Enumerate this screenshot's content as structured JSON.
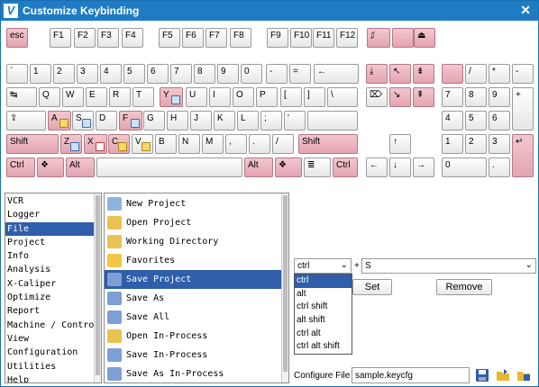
{
  "window": {
    "title": "Customize Keybinding",
    "close_label": "✕",
    "app_icon_letter": "V"
  },
  "keyboard": {
    "keys": [
      [
        "esc",
        6,
        8,
        24,
        "p",
        ""
      ],
      [
        "F1",
        54,
        8,
        24,
        "",
        ""
      ],
      [
        "F2",
        81,
        8,
        24,
        "",
        ""
      ],
      [
        "F3",
        107,
        8,
        24,
        "",
        ""
      ],
      [
        "F4",
        134,
        8,
        24,
        "",
        ""
      ],
      [
        "F5",
        175,
        8,
        24,
        "",
        ""
      ],
      [
        "F6",
        201,
        8,
        24,
        "",
        ""
      ],
      [
        "F7",
        227,
        8,
        24,
        "",
        ""
      ],
      [
        "F8",
        254,
        8,
        24,
        "",
        ""
      ],
      [
        "F9",
        295,
        8,
        24,
        "",
        ""
      ],
      [
        "F10",
        321,
        8,
        24,
        "",
        ""
      ],
      [
        "F11",
        346,
        8,
        24,
        "",
        ""
      ],
      [
        "F12",
        372,
        8,
        24,
        "",
        ""
      ],
      [
        "⎎",
        406,
        8,
        26,
        "p",
        ""
      ],
      [
        "",
        434,
        8,
        24,
        "p",
        ""
      ],
      [
        "⏏",
        458,
        8,
        24,
        "p",
        ""
      ],
      [
        "`",
        6,
        48,
        24,
        "",
        ""
      ],
      [
        "1",
        32,
        48,
        24,
        "",
        ""
      ],
      [
        "2",
        58,
        48,
        24,
        "",
        ""
      ],
      [
        "3",
        84,
        48,
        24,
        "",
        ""
      ],
      [
        "4",
        110,
        48,
        24,
        "",
        ""
      ],
      [
        "5",
        136,
        48,
        24,
        "",
        ""
      ],
      [
        "6",
        162,
        48,
        24,
        "",
        ""
      ],
      [
        "7",
        188,
        48,
        24,
        "",
        ""
      ],
      [
        "8",
        214,
        48,
        24,
        "",
        ""
      ],
      [
        "9",
        240,
        48,
        24,
        "",
        ""
      ],
      [
        "0",
        266,
        48,
        24,
        "",
        ""
      ],
      [
        "-",
        294,
        48,
        24,
        "",
        ""
      ],
      [
        "=",
        320,
        48,
        24,
        "",
        ""
      ],
      [
        "←",
        347,
        48,
        50,
        "",
        ""
      ],
      [
        "⤓",
        405,
        48,
        24,
        "p",
        ""
      ],
      [
        "↖",
        431,
        48,
        24,
        "p",
        ""
      ],
      [
        "⇟",
        457,
        48,
        24,
        "p",
        ""
      ],
      [
        "",
        489,
        48,
        24,
        "p",
        ""
      ],
      [
        "/",
        515,
        48,
        24,
        "",
        ""
      ],
      [
        "*",
        541,
        48,
        24,
        "",
        ""
      ],
      [
        "-",
        567,
        48,
        24,
        "",
        ""
      ],
      [
        "↹",
        6,
        74,
        34,
        "",
        ""
      ],
      [
        "Q",
        42,
        74,
        24,
        "",
        ""
      ],
      [
        "W",
        68,
        74,
        24,
        "",
        ""
      ],
      [
        "E",
        94,
        74,
        24,
        "",
        ""
      ],
      [
        "R",
        120,
        74,
        24,
        "",
        ""
      ],
      [
        "T",
        146,
        74,
        24,
        "",
        ""
      ],
      [
        "Y",
        176,
        74,
        26,
        "p",
        "b"
      ],
      [
        "U",
        205,
        74,
        24,
        "",
        ""
      ],
      [
        "I",
        231,
        74,
        24,
        "",
        ""
      ],
      [
        "O",
        257,
        74,
        24,
        "",
        ""
      ],
      [
        "P",
        283,
        74,
        24,
        "",
        ""
      ],
      [
        "[",
        310,
        74,
        24,
        "",
        ""
      ],
      [
        "]",
        336,
        74,
        24,
        "",
        ""
      ],
      [
        "\\",
        362,
        74,
        34,
        "",
        ""
      ],
      [
        "⌦",
        405,
        74,
        24,
        "",
        ""
      ],
      [
        "↘",
        431,
        74,
        24,
        "p",
        ""
      ],
      [
        "⇞",
        457,
        74,
        24,
        "p",
        ""
      ],
      [
        "7",
        489,
        74,
        24,
        "",
        ""
      ],
      [
        "8",
        515,
        74,
        24,
        "",
        ""
      ],
      [
        "9",
        541,
        74,
        24,
        "",
        ""
      ],
      [
        "+",
        567,
        74,
        24,
        "",
        ""
      ],
      [
        "⇪",
        6,
        100,
        44,
        "",
        ""
      ],
      [
        "A",
        52,
        100,
        26,
        "p",
        "y"
      ],
      [
        "S",
        79,
        100,
        24,
        "",
        "b"
      ],
      [
        "D",
        105,
        100,
        24,
        "",
        ""
      ],
      [
        "F",
        131,
        100,
        26,
        "p",
        "b"
      ],
      [
        "G",
        158,
        100,
        24,
        "",
        ""
      ],
      [
        "H",
        184,
        100,
        24,
        "",
        ""
      ],
      [
        "J",
        210,
        100,
        24,
        "",
        ""
      ],
      [
        "K",
        236,
        100,
        24,
        "",
        ""
      ],
      [
        "L",
        262,
        100,
        24,
        "",
        ""
      ],
      [
        ";",
        288,
        100,
        24,
        "",
        ""
      ],
      [
        "'",
        314,
        100,
        24,
        "",
        ""
      ],
      [
        "",
        340,
        100,
        56,
        "",
        ""
      ],
      [
        "4",
        489,
        100,
        24,
        "",
        ""
      ],
      [
        "5",
        515,
        100,
        24,
        "",
        ""
      ],
      [
        "6",
        541,
        100,
        24,
        "",
        ""
      ],
      [
        "Shift",
        6,
        126,
        58,
        "p",
        ""
      ],
      [
        "Z",
        66,
        126,
        24,
        "p",
        "b"
      ],
      [
        "X",
        92,
        126,
        26,
        "p",
        "r"
      ],
      [
        "C",
        119,
        126,
        24,
        "p",
        "y"
      ],
      [
        "V",
        145,
        126,
        24,
        "",
        "y"
      ],
      [
        "B",
        171,
        126,
        24,
        "",
        ""
      ],
      [
        "N",
        197,
        126,
        24,
        "",
        ""
      ],
      [
        "M",
        223,
        126,
        24,
        "",
        ""
      ],
      [
        ",",
        249,
        126,
        24,
        "",
        ""
      ],
      [
        ".",
        275,
        126,
        24,
        "",
        ""
      ],
      [
        "/",
        301,
        126,
        24,
        "",
        ""
      ],
      [
        "Shift",
        330,
        126,
        66,
        "p",
        ""
      ],
      [
        "↑",
        431,
        126,
        24,
        "",
        ""
      ],
      [
        "1",
        489,
        126,
        24,
        "",
        ""
      ],
      [
        "2",
        515,
        126,
        24,
        "",
        ""
      ],
      [
        "3",
        541,
        126,
        24,
        "",
        ""
      ],
      [
        "↵",
        567,
        126,
        24,
        "p",
        ""
      ],
      [
        "Ctrl",
        6,
        152,
        32,
        "p",
        ""
      ],
      [
        "❖",
        40,
        152,
        30,
        "p",
        ""
      ],
      [
        "Alt",
        72,
        152,
        32,
        "p",
        ""
      ],
      [
        "",
        106,
        152,
        162,
        "",
        ""
      ],
      [
        "Alt",
        270,
        152,
        32,
        "p",
        ""
      ],
      [
        "❖",
        304,
        152,
        30,
        "p",
        ""
      ],
      [
        "≣",
        336,
        152,
        30,
        "",
        ""
      ],
      [
        "Ctrl",
        368,
        152,
        28,
        "p",
        ""
      ],
      [
        "←",
        405,
        152,
        24,
        "",
        ""
      ],
      [
        "↓",
        431,
        152,
        24,
        "",
        ""
      ],
      [
        "→",
        457,
        152,
        24,
        "",
        ""
      ],
      [
        "0",
        489,
        152,
        50,
        "",
        ""
      ],
      [
        ".",
        541,
        152,
        24,
        "",
        ""
      ]
    ]
  },
  "categories": {
    "items": [
      "VCR",
      "Logger",
      "File",
      "Project",
      "Info",
      "Analysis",
      "X-Caliper",
      "Optimize",
      "Report",
      "Machine / Control",
      "View",
      "Configuration",
      "Utilities",
      "Help"
    ],
    "selected": 2
  },
  "commands": {
    "items": [
      {
        "label": "New Project",
        "icon": "new-project-icon",
        "color": "#8fb3e0"
      },
      {
        "label": "Open Project",
        "icon": "open-project-icon",
        "color": "#e8c352"
      },
      {
        "label": "Working Directory",
        "icon": "working-directory-icon",
        "color": "#e8c352"
      },
      {
        "label": "Favorites",
        "icon": "favorites-star-icon",
        "color": "#f2c744"
      },
      {
        "label": "Save Project",
        "icon": "save-project-icon",
        "color": "#7d9fd6"
      },
      {
        "label": "Save As",
        "icon": "save-as-icon",
        "color": "#7d9fd6"
      },
      {
        "label": "Save All",
        "icon": "save-all-icon",
        "color": "#7d9fd6"
      },
      {
        "label": "Open In-Process",
        "icon": "open-in-process-icon",
        "color": "#e8c352"
      },
      {
        "label": "Save In-Process",
        "icon": "save-in-process-icon",
        "color": "#7d9fd6"
      },
      {
        "label": "Save As In-Process",
        "icon": "save-as-in-process-icon",
        "color": "#7d9fd6"
      }
    ],
    "selected": 4
  },
  "binding": {
    "modifier": "ctrl",
    "plus": "+",
    "key": "S",
    "set_label": "Set",
    "remove_label": "Remove",
    "modifier_options": [
      "ctrl",
      "alt",
      "ctrl shift",
      "alt shift",
      "ctrl alt",
      "ctrl alt shift"
    ],
    "modifier_selected": 0
  },
  "config": {
    "label": "Configure File",
    "value": "sample.keycfg"
  },
  "colors": {
    "titlebar": "#1f7cc4",
    "selection": "#2f5eaa",
    "pink_key": "#e3a4b0"
  }
}
